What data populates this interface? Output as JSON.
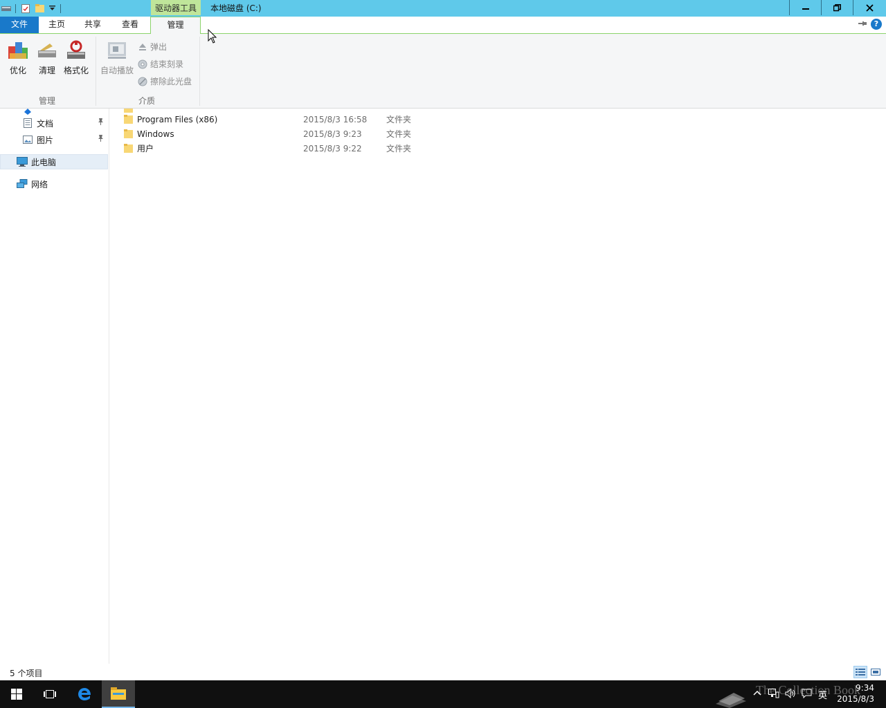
{
  "titlebar": {
    "context_tab": "驱动器工具",
    "window_title": "本地磁盘 (C:)"
  },
  "ribbon_tabs": {
    "file": "文件",
    "home": "主页",
    "share": "共享",
    "view": "查看",
    "manage": "管理"
  },
  "ribbon": {
    "optimize": "优化",
    "cleanup": "清理",
    "format": "格式化",
    "autoplay": "自动播放",
    "eject": "弹出",
    "finish_burn": "结束刻录",
    "erase_disc": "擦除此光盘",
    "group_manage": "管理",
    "group_media": "介质"
  },
  "nav": {
    "items": [
      {
        "label": "文档",
        "pinned": true
      },
      {
        "label": "图片",
        "pinned": true
      },
      {
        "label": "此电脑",
        "selected": true
      },
      {
        "label": "网络"
      }
    ]
  },
  "files": [
    {
      "name": "Program Files (x86)",
      "date": "2015/8/3 16:58",
      "type": "文件夹"
    },
    {
      "name": "Windows",
      "date": "2015/8/3 9:23",
      "type": "文件夹"
    },
    {
      "name": "用户",
      "date": "2015/8/3 9:22",
      "type": "文件夹"
    }
  ],
  "status": {
    "item_count": "5 个项目"
  },
  "taskbar": {
    "ime": "英",
    "time": "9:34",
    "date": "2015/8/3",
    "watermark": "The Collection Book"
  },
  "colors": {
    "titlebar": "#5fc9ea",
    "context_tab": "#bfe59a",
    "file_tab": "#1979ca",
    "taskbar": "#101010"
  }
}
